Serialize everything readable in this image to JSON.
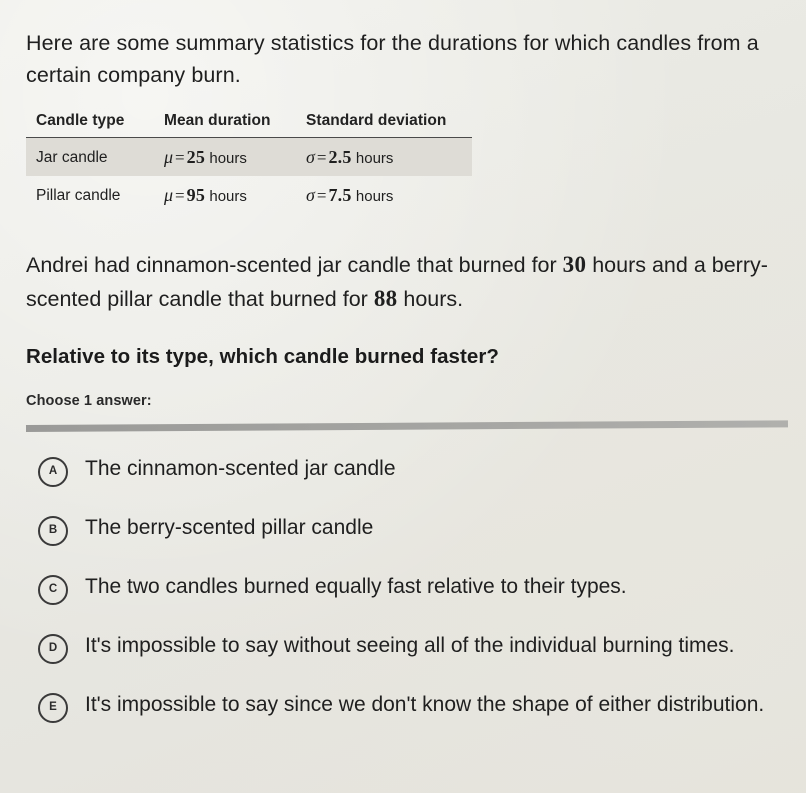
{
  "prompt": "Here are some summary statistics for the durations for which candles from a certain company burn.",
  "table": {
    "headers": [
      "Candle type",
      "Mean duration",
      "Standard deviation"
    ],
    "rows": [
      {
        "type": "Jar candle",
        "mean_symbol": "μ",
        "mean_eq": "=",
        "mean_value": "25",
        "mean_unit": "hours",
        "sd_symbol": "σ",
        "sd_eq": "=",
        "sd_value": "2.5",
        "sd_unit": "hours",
        "shaded": true
      },
      {
        "type": "Pillar candle",
        "mean_symbol": "μ",
        "mean_eq": "=",
        "mean_value": "95",
        "mean_unit": "hours",
        "sd_symbol": "σ",
        "sd_eq": "=",
        "sd_value": "7.5",
        "sd_unit": "hours",
        "shaded": false
      }
    ]
  },
  "scenario": {
    "part1": "Andrei had cinnamon-scented jar candle that burned for ",
    "num1": "30",
    "part2": " hours and a berry-scented pillar candle that burned for ",
    "num2": "88",
    "part3": " hours."
  },
  "question": "Relative to its type, which candle burned faster?",
  "choose_label": "Choose 1 answer:",
  "choices": [
    {
      "letter": "A",
      "text": "The cinnamon-scented jar candle"
    },
    {
      "letter": "B",
      "text": "The berry-scented pillar candle"
    },
    {
      "letter": "C",
      "text": "The two candles burned equally fast relative to their types."
    },
    {
      "letter": "D",
      "text": "It's impossible to say without seeing all of the individual burning times."
    },
    {
      "letter": "E",
      "text": "It's impossible to say since we don't know the shape of either distribution."
    }
  ],
  "colors": {
    "background": "#e9e9e4",
    "text": "#1f1f1f",
    "row_shade": "#dedcd6",
    "divider": "#a4a4a1",
    "rule": "#4a4a4a"
  }
}
